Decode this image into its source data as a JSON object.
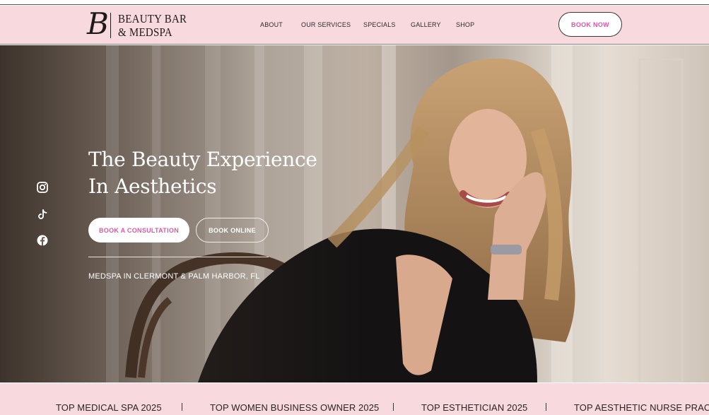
{
  "brand": {
    "logo_letter": "B",
    "logo_line1": "BEAUTY BAR",
    "logo_line2": "& MEDSPA"
  },
  "nav": {
    "items": [
      "ABOUT",
      "OUR SERVICES",
      "SPECIALS",
      "GALLERY",
      "SHOP"
    ],
    "cta": "BOOK NOW"
  },
  "hero": {
    "title_line1": "The Beauty Experience",
    "title_line2": "In Aesthetics",
    "primary_button": "BOOK A CONSULTATION",
    "secondary_button": "BOOK ONLINE",
    "subtitle": "MEDSPA IN CLERMONT & PALM HARBOR, FL",
    "image_description_icon": "hero-photo"
  },
  "social": {
    "icons": [
      "instagram-icon",
      "tiktok-icon",
      "facebook-icon"
    ]
  },
  "ticker": {
    "items": [
      "TOP MEDICAL SPA 2025",
      "TOP WOMEN BUSINESS OWNER 2025",
      "TOP ESTHETICIAN 2025",
      "TOP AESTHETIC NURSE PRACTIT"
    ]
  },
  "colors": {
    "header_bg": "#f8d9de",
    "accent_pink": "#d75aa6",
    "text_dark": "#2e2a2b"
  }
}
